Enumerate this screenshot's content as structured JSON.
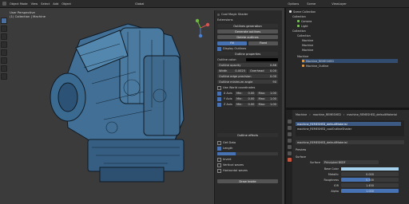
{
  "topbar": {
    "object_mode": "Object Mode",
    "menus": [
      "View",
      "Select",
      "Add",
      "Object"
    ],
    "transform": "Global",
    "scene": "Scene",
    "view_layer": "ViewLayer",
    "options": "Options"
  },
  "viewport": {
    "line1": "User Perspective",
    "line2": "(1) Collection | Machine"
  },
  "npanel": {
    "title": "Cool Magic Shader",
    "extensions": "Extensions",
    "outline_generation": "Outlines generation",
    "generate_outlines": "Generate outlines",
    "delete_outlines": "Delete outlines",
    "fill": "Fill",
    "fixed": "Fixed",
    "display_outlines": "Display Outlines",
    "outline_properties": "Outline properties",
    "outline_color": "Outline color:",
    "rows": [
      {
        "label": "Outline opacity",
        "value": "0.86"
      },
      {
        "label": "Width",
        "value": "0.0025"
      },
      {
        "label": "Overhead",
        "value": "0.00"
      },
      {
        "label": "Outline edge precision",
        "value": "0.00"
      },
      {
        "label": "Outline minimum angle",
        "value": "90"
      }
    ],
    "use_world_coords": "Use World coordinates",
    "axes": [
      {
        "label": "X Axis",
        "min": "Min:",
        "min_val": "0.00",
        "max": "Max:",
        "max_val": "1.00"
      },
      {
        "label": "Y Axis",
        "min": "Min:",
        "min_val": "0.00",
        "max": "Max:",
        "max_val": "1.00"
      },
      {
        "label": "Z Axis",
        "min": "Min:",
        "min_val": "0.00",
        "max": "Max:",
        "max_val": "1.00"
      }
    ],
    "outline_effects": "Outline effects",
    "effects": [
      "Get Data",
      "Length",
      "Invert",
      "Vertical waves",
      "Horizontal waves"
    ],
    "draw_inside": "Draw Inside"
  },
  "outliner": {
    "title": "Scene Collection",
    "items": [
      {
        "label": "Collection",
        "indent": 1
      },
      {
        "label": "Camera",
        "indent": 2
      },
      {
        "label": "Light",
        "indent": 2
      },
      {
        "label": "Collection",
        "indent": 1
      },
      {
        "label": "Collection",
        "indent": 2
      },
      {
        "label": "Machine",
        "indent": 3
      },
      {
        "label": "Machine",
        "indent": 3
      },
      {
        "label": "Machine",
        "indent": 3
      },
      {
        "label": "Machine",
        "indent": 2
      },
      {
        "label": "Machine_REMESHED",
        "indent": 3
      },
      {
        "label": "Machine_Outline",
        "indent": 3
      }
    ]
  },
  "properties": {
    "breadcrumb_obj": "Machine",
    "breadcrumb_mesh": "machine_REMESHED",
    "breadcrumb_mat": "machine_REMESHED_defaultMaterial",
    "slots": [
      "machine_REMESHED_defaultMaterial",
      "machine_REMESHED_coolOutlineShader"
    ],
    "material_field": "machine_REMESHED_defaultMaterial",
    "preview": "Preview",
    "surface_section": "Surface",
    "surface_label": "Surface",
    "surface_value": "Principled BSDF",
    "bsdf_rows": [
      {
        "label": "Base Color",
        "value": ""
      },
      {
        "label": "Metallic",
        "value": "0.000"
      },
      {
        "label": "Roughness",
        "value": "0.500"
      },
      {
        "label": "IOR",
        "value": "1.450"
      },
      {
        "label": "Alpha",
        "value": "1.000"
      }
    ]
  },
  "colors": {
    "accent": "#4772b3",
    "outline_color": "#000000",
    "base_color": "#a6d2ee",
    "mesh_blue": "#3a6d96"
  }
}
